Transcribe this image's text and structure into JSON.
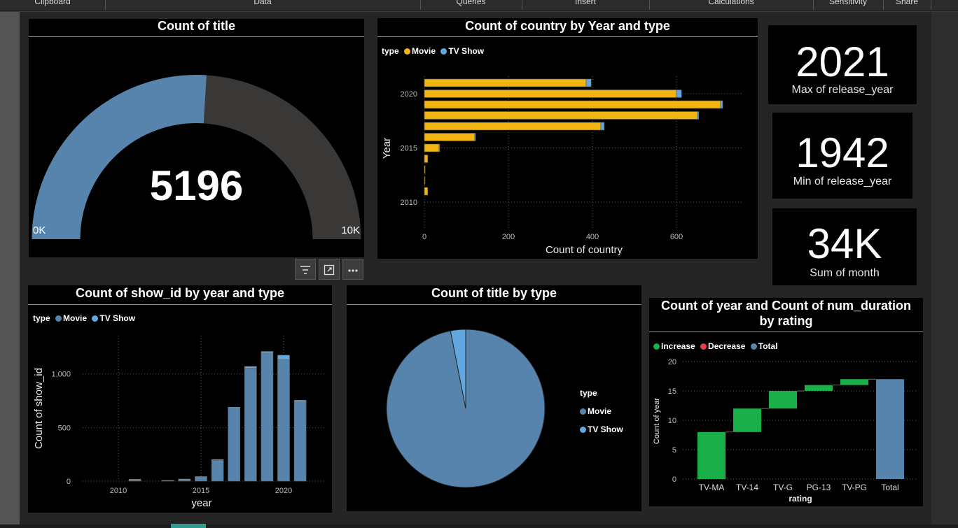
{
  "ribbon": {
    "items": [
      "Clipboard",
      "Data",
      "Queries",
      "Insert",
      "Calculations",
      "Sensitivity",
      "Share"
    ]
  },
  "gauge": {
    "title": "Count of title",
    "value": 5196,
    "value_label": "5196",
    "min": 0,
    "max": 10000,
    "min_label": "0K",
    "max_label": "10K",
    "fill_color": "#5784ad",
    "track_color": "#3a3836"
  },
  "cards": [
    {
      "value": "2021",
      "label": "Max of release_year"
    },
    {
      "value": "1942",
      "label": "Min of release_year"
    },
    {
      "value": "34K",
      "label": "Sum of month"
    }
  ],
  "visual_buttons": [
    "filter-icon",
    "focus-mode-icon",
    "more-options-icon"
  ],
  "bar_h": {
    "title": "Count of country by Year and type",
    "legend_title": "type",
    "legend": [
      {
        "label": "Movie",
        "color": "#f2b411"
      },
      {
        "label": "TV Show",
        "color": "#62a8e0"
      }
    ]
  },
  "col_chart": {
    "title": "Count of show_id by year and type",
    "legend_title": "type",
    "legend": [
      {
        "label": "Movie",
        "color": "#5784ad"
      },
      {
        "label": "TV Show",
        "color": "#62a8e0"
      }
    ]
  },
  "pie": {
    "title": "Count of title by type",
    "legend_title": "type",
    "legend": [
      {
        "label": "Movie",
        "color": "#5784ad"
      },
      {
        "label": "TV Show",
        "color": "#62a8e0"
      }
    ]
  },
  "waterfall": {
    "title_line1": "Count of year and Count of num_duration",
    "title_line2": "by rating",
    "legend": [
      {
        "label": "Increase",
        "color": "#1aaf48"
      },
      {
        "label": "Decrease",
        "color": "#e0414c"
      },
      {
        "label": "Total",
        "color": "#5784ad"
      }
    ]
  },
  "chart_data": [
    {
      "type": "gauge",
      "title": "Count of title",
      "value": 5196,
      "min": 0,
      "max": 10000
    },
    {
      "type": "bar",
      "orientation": "horizontal",
      "stacked": true,
      "title": "Count of country by Year and type",
      "xlabel": "Count of country",
      "ylabel": "Year",
      "xlim": [
        0,
        750
      ],
      "xticks": [
        0,
        200,
        400,
        600
      ],
      "yticks": [
        2010,
        2015,
        2020
      ],
      "categories": [
        2021,
        2020,
        2019,
        2018,
        2017,
        2016,
        2015,
        2014,
        2013,
        2012,
        2011
      ],
      "series": [
        {
          "name": "Movie",
          "color": "#f2b411",
          "values": [
            385,
            600,
            705,
            650,
            420,
            120,
            35,
            8,
            2,
            1,
            8
          ]
        },
        {
          "name": "TV Show",
          "color": "#62a8e0",
          "values": [
            12,
            12,
            5,
            3,
            8,
            2,
            1,
            0,
            0,
            0,
            0
          ]
        }
      ],
      "grid": true,
      "legend_position": "top-left"
    },
    {
      "type": "bar",
      "stacked": true,
      "title": "Count of show_id by year and type",
      "xlabel": "year",
      "ylabel": "Count of show_id",
      "ylim": [
        0,
        1350
      ],
      "yticks": [
        0,
        500,
        1000
      ],
      "ytick_labels": [
        "0",
        "500",
        "1,000"
      ],
      "xticks": [
        2010,
        2015,
        2020
      ],
      "categories": [
        2010,
        2011,
        2012,
        2013,
        2014,
        2015,
        2016,
        2017,
        2018,
        2019,
        2020,
        2021
      ],
      "series": [
        {
          "name": "Movie",
          "color": "#5784ad",
          "values": [
            0,
            10,
            0,
            3,
            12,
            35,
            195,
            680,
            1055,
            1195,
            1135,
            740
          ]
        },
        {
          "name": "TV Show",
          "color": "#62a8e0",
          "values": [
            0,
            3,
            0,
            0,
            2,
            3,
            2,
            10,
            15,
            15,
            40,
            15
          ]
        }
      ],
      "grid": true,
      "legend_position": "top-left"
    },
    {
      "type": "pie",
      "title": "Count of title by type",
      "categories": [
        "Movie",
        "TV Show"
      ],
      "values": [
        5036,
        160
      ],
      "colors": [
        "#5784ad",
        "#62a8e0"
      ],
      "legend_position": "right"
    },
    {
      "type": "waterfall",
      "title": "Count of year and Count of num_duration by rating",
      "xlabel": "rating",
      "ylabel": "Count of year",
      "ylim": [
        0,
        20
      ],
      "yticks": [
        0,
        5,
        10,
        15,
        20
      ],
      "categories": [
        "TV-MA",
        "TV-14",
        "TV-G",
        "PG-13",
        "TV-PG",
        "Total"
      ],
      "values": [
        8,
        4,
        3,
        1,
        1,
        17
      ],
      "kinds": [
        "increase",
        "increase",
        "increase",
        "increase",
        "increase",
        "total"
      ],
      "legend": [
        "Increase",
        "Decrease",
        "Total"
      ],
      "grid": true,
      "legend_position": "top-left"
    }
  ]
}
